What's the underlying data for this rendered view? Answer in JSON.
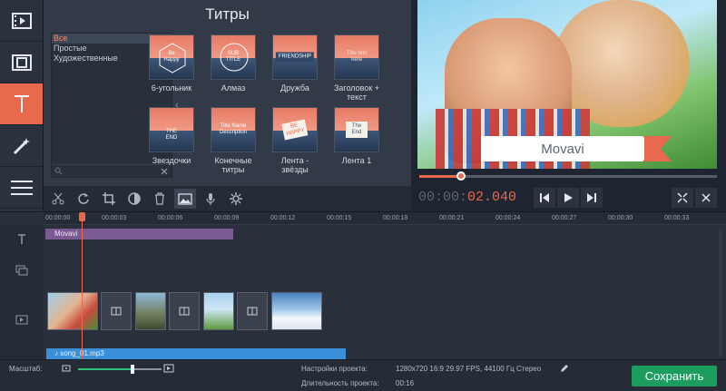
{
  "panel": {
    "title": "Титры"
  },
  "categories": [
    "Все",
    "Простые",
    "Художественные"
  ],
  "titles": [
    {
      "label": "6-угольник",
      "deco": "Be Happy"
    },
    {
      "label": "Алмаз",
      "deco": "SUB TITLE"
    },
    {
      "label": "Дружба",
      "deco": "FRIENDSHIP"
    },
    {
      "label": "Заголовок +\nтекст",
      "deco": "Title text here"
    },
    {
      "label": "Звездочки",
      "deco": "THE END"
    },
    {
      "label": "Конечные\nтитры",
      "deco": "Title Name Description"
    },
    {
      "label": "Лента -\nзвёзды",
      "deco": "BE HAPPY"
    },
    {
      "label": "Лента 1",
      "deco": "The End"
    }
  ],
  "preview": {
    "title_text": "Movavi",
    "progress": 0.14
  },
  "timecode": {
    "static": "00:00:",
    "live": "02.040"
  },
  "ruler_ticks": [
    "00:00:00",
    "00:00:03",
    "00:00:06",
    "00:00:09",
    "00:00:12",
    "00:00:15",
    "00:00:18",
    "00:00:21",
    "00:00:24",
    "00:00:27",
    "00:00:30",
    "00:00:33"
  ],
  "timeline": {
    "title_clip": "Movavi",
    "audio_clip": "song_01.mp3"
  },
  "status": {
    "zoom_label": "Масштаб:",
    "zoom_level": 0.65,
    "settings_label": "Настройки проекта:",
    "settings_value": "1280x720 16:9 29.97 FPS, 44100 Гц Стерео",
    "duration_label": "Длительность проекта:",
    "duration_value": "00:16",
    "save_label": "Сохранить"
  },
  "colors": {
    "accent": "#e8694e",
    "save": "#1d9c5f",
    "title_clip": "#7b5a93",
    "audio_clip": "#3a8fd9"
  }
}
